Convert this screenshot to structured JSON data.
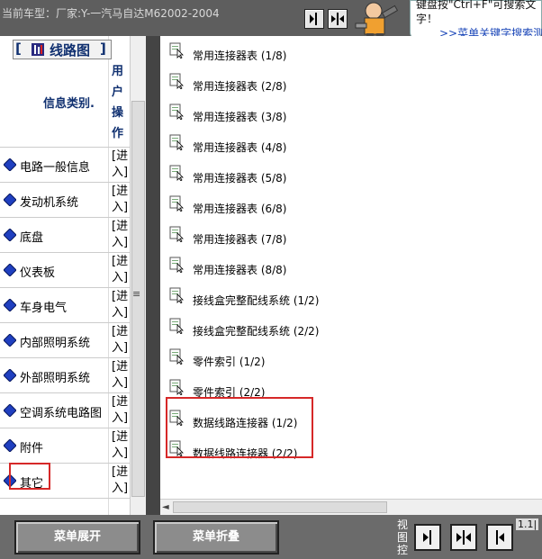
{
  "header": {
    "vehicle": "当前车型：厂家:Y-一汽马自达M62002-2004",
    "tip_text": "键盘按\"Ctrl+F\"可搜索文字！",
    "tip_link": ">>菜单关键字搜索测"
  },
  "left_panel": {
    "title": "线路图",
    "col_info": "信息类别.",
    "col_user": "用户操作",
    "enter_label": "[进入]",
    "categories": [
      {
        "label": "电路一般信息"
      },
      {
        "label": "发动机系统"
      },
      {
        "label": "底盘"
      },
      {
        "label": "仪表板"
      },
      {
        "label": "车身电气"
      },
      {
        "label": "内部照明系统"
      },
      {
        "label": "外部照明系统"
      },
      {
        "label": "空调系统电路图"
      },
      {
        "label": "附件"
      },
      {
        "label": "其它"
      }
    ]
  },
  "right_panel": {
    "entries": [
      {
        "label": "常用连接器表 (1/8)"
      },
      {
        "label": "常用连接器表 (2/8)"
      },
      {
        "label": "常用连接器表 (3/8)"
      },
      {
        "label": "常用连接器表 (4/8)"
      },
      {
        "label": "常用连接器表 (5/8)"
      },
      {
        "label": "常用连接器表 (6/8)"
      },
      {
        "label": "常用连接器表 (7/8)"
      },
      {
        "label": "常用连接器表 (8/8)"
      },
      {
        "label": "接线盒完整配线系统 (1/2)"
      },
      {
        "label": "接线盒完整配线系统 (2/2)"
      },
      {
        "label": "零件索引 (1/2)"
      },
      {
        "label": "零件索引 (2/2)"
      },
      {
        "label": "数据线路连接器 (1/2)"
      },
      {
        "label": "数据线路连接器 (2/2)"
      }
    ]
  },
  "footer": {
    "expand_label": "菜单展开",
    "collapse_label": "菜单折叠",
    "view_label": "视图控",
    "version": "1.1|"
  },
  "colors": {
    "highlight": "#d62828",
    "title": "#103070",
    "link": "#1a46b8"
  }
}
